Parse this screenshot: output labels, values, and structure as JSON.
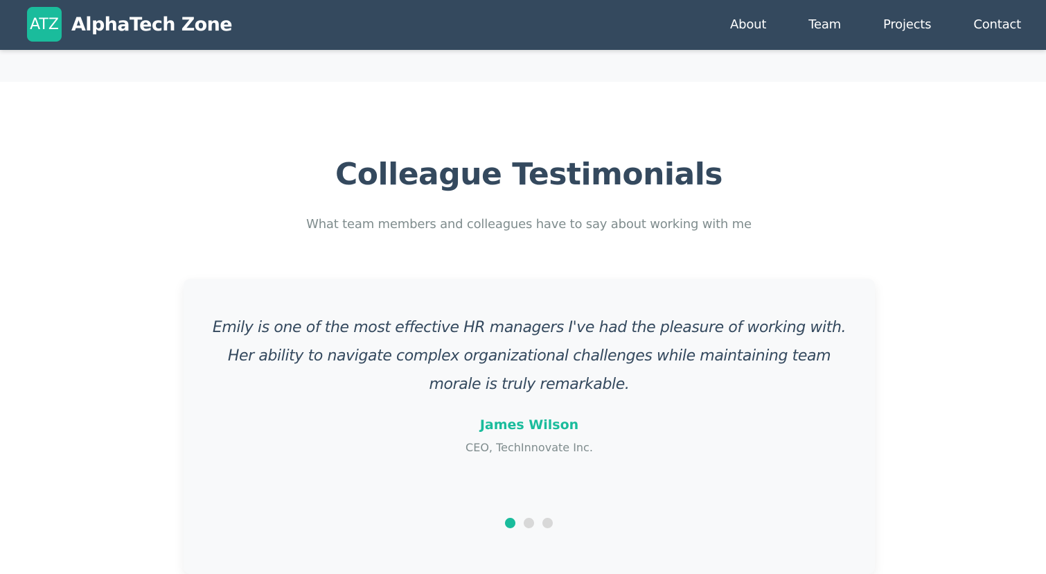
{
  "colors": {
    "nav_background": "#34495e",
    "accent": "#1abc9c",
    "heading": "#34495e",
    "muted_text": "#7f8c8d",
    "card_background": "#f8f9fa",
    "dot_inactive": "#d8d8d8"
  },
  "header": {
    "logo_text": "ATZ",
    "brand_name": "AlphaTech Zone",
    "nav": [
      {
        "label": "About"
      },
      {
        "label": "Team"
      },
      {
        "label": "Projects"
      },
      {
        "label": "Contact"
      }
    ]
  },
  "testimonials": {
    "title": "Colleague Testimonials",
    "subtitle": "What team members and colleagues have to say about working with me",
    "current": {
      "quote": "Emily is one of the most effective HR managers I've had the pleasure of working with. Her ability to navigate complex organizational challenges while maintaining team morale is truly remarkable.",
      "author": "James Wilson",
      "role": "CEO, TechInnovate Inc."
    },
    "pagination": {
      "total": 3,
      "active_index": 0
    }
  }
}
